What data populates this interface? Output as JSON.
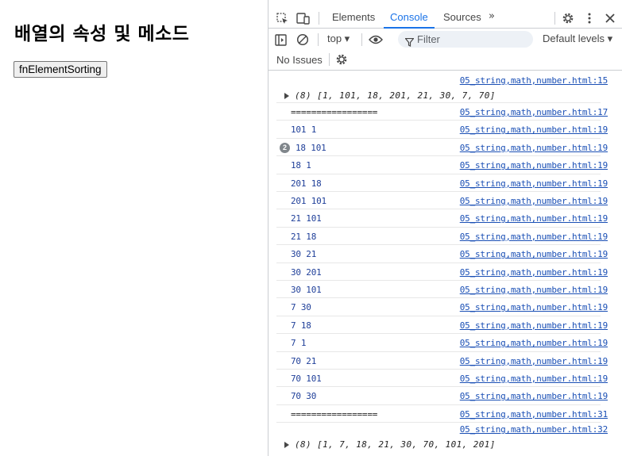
{
  "page": {
    "title": "배열의 속성 및 메소드",
    "button_label": "fnElementSorting"
  },
  "devtools": {
    "tabs": [
      "Elements",
      "Console",
      "Sources"
    ],
    "active_tab": "Console",
    "more_tabs_glyph": "»",
    "context": "top ▾",
    "filter_placeholder": "Filter",
    "levels": "Default levels ▾",
    "issues": "No Issues",
    "accent_color": "#1a73e8"
  },
  "console": {
    "first_source": "05_string,math,number.html:15",
    "first_array": "(8) [1, 101, 18, 201, 21, 30, 7, 70]",
    "rows": [
      {
        "msg": "=================",
        "src": "05_string,math,number.html:17",
        "count": ""
      },
      {
        "msg": "101 1",
        "src": "05_string,math,number.html:19",
        "count": ""
      },
      {
        "msg": "18 101",
        "src": "05_string,math,number.html:19",
        "count": "2"
      },
      {
        "msg": "18 1",
        "src": "05_string,math,number.html:19",
        "count": ""
      },
      {
        "msg": "201 18",
        "src": "05_string,math,number.html:19",
        "count": ""
      },
      {
        "msg": "201 101",
        "src": "05_string,math,number.html:19",
        "count": ""
      },
      {
        "msg": "21 101",
        "src": "05_string,math,number.html:19",
        "count": ""
      },
      {
        "msg": "21 18",
        "src": "05_string,math,number.html:19",
        "count": ""
      },
      {
        "msg": "30 21",
        "src": "05_string,math,number.html:19",
        "count": ""
      },
      {
        "msg": "30 201",
        "src": "05_string,math,number.html:19",
        "count": ""
      },
      {
        "msg": "30 101",
        "src": "05_string,math,number.html:19",
        "count": ""
      },
      {
        "msg": "7 30",
        "src": "05_string,math,number.html:19",
        "count": ""
      },
      {
        "msg": "7 18",
        "src": "05_string,math,number.html:19",
        "count": ""
      },
      {
        "msg": "7 1",
        "src": "05_string,math,number.html:19",
        "count": ""
      },
      {
        "msg": "70 21",
        "src": "05_string,math,number.html:19",
        "count": ""
      },
      {
        "msg": "70 101",
        "src": "05_string,math,number.html:19",
        "count": ""
      },
      {
        "msg": "70 30",
        "src": "05_string,math,number.html:19",
        "count": ""
      },
      {
        "msg": "=================",
        "src": "05_string,math,number.html:31",
        "count": ""
      }
    ],
    "last_source": "05_string,math,number.html:32",
    "last_array": "(8) [1, 7, 18, 21, 30, 70, 101, 201]"
  }
}
